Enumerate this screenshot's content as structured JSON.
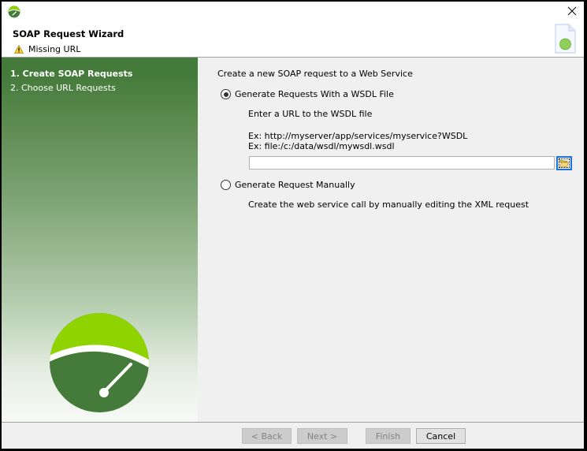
{
  "window": {
    "title": "SOAP Request Wizard",
    "status_icon": "warning-icon",
    "status_text": "Missing URL",
    "close_icon": "close-icon"
  },
  "steps": [
    {
      "label": "1. Create SOAP Requests",
      "active": true
    },
    {
      "label": "2. Choose URL Requests",
      "active": false
    }
  ],
  "main": {
    "intro": "Create a new SOAP request to a Web Service",
    "options": [
      {
        "label": "Generate Requests With a WSDL File",
        "selected": true,
        "description": "Enter a URL to the WSDL file",
        "examples": [
          "Ex: http://myserver/app/services/myservice?WSDL",
          "Ex: file:/c:/data/wsdl/mywsdl.wsdl"
        ],
        "url_value": "",
        "browse_icon": "folder-open-icon"
      },
      {
        "label": "Generate Request Manually",
        "selected": false,
        "description": "Create the web service call by manually editing the XML request"
      }
    ]
  },
  "footer": {
    "back_label": "< Back",
    "next_label": "Next >",
    "finish_label": "Finish",
    "cancel_label": "Cancel"
  },
  "colors": {
    "brand_dark_green": "#447a3a",
    "brand_light_green": "#8fd400",
    "focus_blue": "#1a73d9"
  }
}
